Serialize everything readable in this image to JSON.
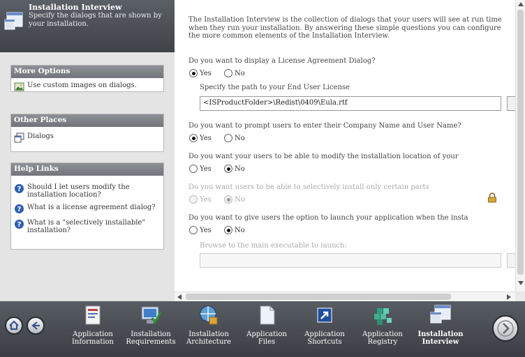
{
  "header": {
    "title": "Installation Interview",
    "subtitle": "Specify the dialogs that are shown by your installation."
  },
  "sidebar": {
    "more_options": {
      "title": "More Options",
      "items": [
        {
          "label": "Use custom images on dialogs."
        }
      ]
    },
    "other_places": {
      "title": "Other Places",
      "items": [
        {
          "label": "Dialogs"
        }
      ]
    },
    "help_links": {
      "title": "Help Links",
      "items": [
        {
          "label": "Should I let users modify the installation location?"
        },
        {
          "label": "What is a license agreement dialog?"
        },
        {
          "label": "What is a \"selectively installable\" installation?"
        }
      ]
    }
  },
  "main": {
    "intro": "The Installation Interview is the collection of dialogs that your users will see at run time when they run your installation. By answering these simple questions you can configure the more common elements of the Installation Interview.",
    "q1": "Do you want to display a License Agreement Dialog?",
    "q1_yes": "Yes",
    "q1_no": "No",
    "license_path_label": "Specify the path to your End User License",
    "license_path_value": "<ISProductFolder>\\Redist\\0409\\Eula.rtf",
    "q2": "Do you want to prompt users to enter their Company Name and User Name?",
    "q2_yes": "Yes",
    "q2_no": "No",
    "q3": "Do you want your users to be able to modify the installation location of your",
    "q3_yes": "Yes",
    "q3_no": "No",
    "q4": "Do you want users to be able to selectively install only certain parts",
    "q4_yes": "Yes",
    "q4_no": "No",
    "q5": "Do you want to give users the option to launch your application when the insta",
    "q5_yes": "Yes",
    "q5_no": "No",
    "browse_label": "Browse to the main executable to launch:",
    "browse_value": ""
  },
  "footer": {
    "items": [
      {
        "label1": "Application",
        "label2": "Information",
        "active": false
      },
      {
        "label1": "Installation",
        "label2": "Requirements",
        "active": false
      },
      {
        "label1": "Installation",
        "label2": "Architecture",
        "active": false
      },
      {
        "label1": "Application",
        "label2": "Files",
        "active": false
      },
      {
        "label1": "Application",
        "label2": "Shortcuts",
        "active": false
      },
      {
        "label1": "Application",
        "label2": "Registry",
        "active": false
      },
      {
        "label1": "Installation",
        "label2": "Interview",
        "active": true
      }
    ]
  },
  "colors": {
    "header_bg": "#4a4d53",
    "panel_header": "#7f8389",
    "sidebar_bg": "#e4e4e4",
    "link_icon": "#2f5fb3"
  }
}
